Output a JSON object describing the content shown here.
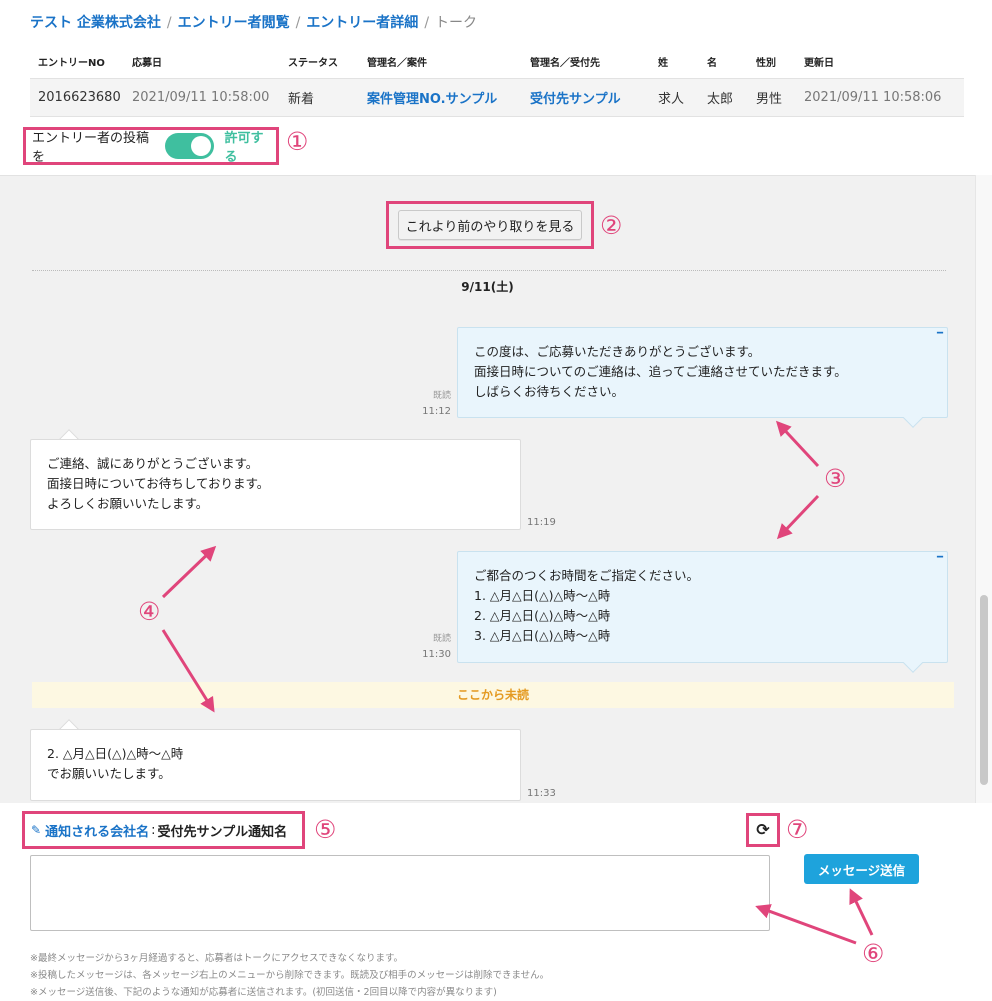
{
  "breadcrumb": {
    "items": [
      "テスト 企業株式会社",
      "エントリー者閲覧",
      "エントリー者詳細"
    ],
    "separator": "/",
    "current": "トーク"
  },
  "entry_table": {
    "headers": [
      "エントリーNO",
      "応募日",
      "ステータス",
      "管理名／案件",
      "管理名／受付先",
      "姓",
      "名",
      "性別",
      "更新日"
    ],
    "row": [
      "2016623680",
      "2021/09/11 10:58:00",
      "新着",
      "案件管理NO.サンプル",
      "受付先サンプル",
      "求人",
      "太郎",
      "男性",
      "2021/09/11 10:58:06"
    ]
  },
  "allow_post": {
    "label": "エントリー者の投稿を",
    "state_label": "許可する",
    "enabled": true
  },
  "chat": {
    "older_button": "これより前のやり取りを見る",
    "date_label": "9/11(土)",
    "unread_label": "ここから未読",
    "messages": [
      {
        "side": "right",
        "lines": [
          "この度は、ご応募いただきありがとうございます。",
          "面接日時についてのご連絡は、追ってご連絡させていただきます。",
          "しばらくお待ちください。"
        ],
        "read": "既読",
        "time": "11:12",
        "menu_icon": "dash-menu-icon"
      },
      {
        "side": "left",
        "lines": [
          "ご連絡、誠にありがとうございます。",
          "面接日時についてお待ちしております。",
          "よろしくお願いいたします。"
        ],
        "time": "11:19"
      },
      {
        "side": "right",
        "lines": [
          "ご都合のつくお時間をご指定ください。",
          "1. △月△日(△)△時～△時",
          "2. △月△日(△)△時～△時",
          "3. △月△日(△)△時～△時"
        ],
        "read": "既読",
        "time": "11:30",
        "menu_icon": "dash-menu-icon"
      },
      {
        "side": "left",
        "lines": [
          "2. △月△日(△)△時～△時",
          "でお願いいたします。"
        ],
        "time": "11:33"
      }
    ]
  },
  "notify": {
    "label": "通知される会社名",
    "colon": ":",
    "value": "受付先サンプル通知名",
    "icon": "pencil-icon"
  },
  "refresh_icon": "refresh-icon",
  "send_button": "メッセージ送信",
  "notes": [
    "※最終メッセージから3ヶ月経過すると、応募者はトークにアクセスできなくなります。",
    "※投稿したメッセージは、各メッセージ右上のメニューから削除できます。既読及び相手のメッセージは削除できません。",
    "※メッセージ送信後、下記のような通知が応募者に送信されます。(初回送信・2回目以降で内容が異なります)"
  ],
  "callouts": [
    "①",
    "②",
    "③",
    "④",
    "⑤",
    "⑥",
    "⑦"
  ],
  "colors": {
    "accent_pink": "#e0457b",
    "link_blue": "#1a73c7",
    "toggle_green": "#3fbf9f",
    "send_blue": "#1ea3dc",
    "unread_orange": "#e49a22"
  }
}
